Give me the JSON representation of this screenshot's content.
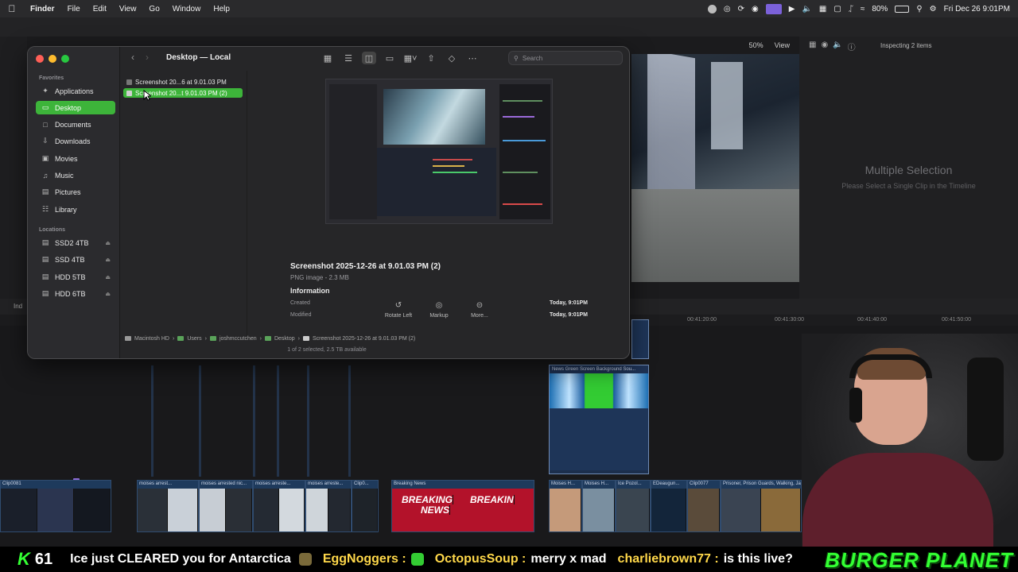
{
  "menubar": {
    "app": "Finder",
    "menus": [
      "File",
      "Edit",
      "View",
      "Go",
      "Window",
      "Help"
    ],
    "battery": "80%",
    "datetime": "Fri Dec 26  9:01PM"
  },
  "viewer": {
    "zoom": "50%",
    "view_label": "View"
  },
  "inspector": {
    "header": "Inspecting 2 items",
    "title": "Multiple Selection",
    "subtitle": "Please Select a Single Clip in the Timeline"
  },
  "timeline": {
    "index_label": "Ind",
    "ruler": [
      "00:41:20:00",
      "00:41:30:00",
      "00:41:40:00",
      "00:41:50:00"
    ],
    "green_screen_clip": "News Green Screen Background Sou...",
    "clips": [
      "Clip0081",
      "moises arrest...",
      "moises arrested nic...",
      "moises arreste...",
      "moises arreste...",
      "Clip0...",
      "Breaking News",
      "Moises H...",
      "Moises H...",
      "Ice Pozol...",
      "EDeaugun...",
      "Clip0077",
      "Prisoner, Prison Guards, Walking, Jail..."
    ],
    "breaking_text": [
      "BREAKING",
      "NEWS",
      "BREAKIN"
    ]
  },
  "finder": {
    "title": "Desktop — Local",
    "search_placeholder": "Search",
    "sidebar": {
      "favorites_label": "Favorites",
      "favorites": [
        "Applications",
        "Desktop",
        "Documents",
        "Downloads",
        "Movies",
        "Music",
        "Pictures",
        "Library"
      ],
      "locations_label": "Locations",
      "locations": [
        "SSD2 4TB",
        "SSD 4TB",
        "HDD 5TB",
        "HDD 6TB"
      ]
    },
    "files": [
      "Screenshot 20...6 at 9.01.03 PM",
      "Screenshot 20...t 9.01.03 PM (2)"
    ],
    "preview": {
      "name": "Screenshot 2025-12-26 at 9.01.03 PM (2)",
      "type": "PNG image - 2.3 MB",
      "info_label": "Information",
      "created_label": "Created",
      "created_value": "Today, 9:01PM",
      "modified_label": "Modified",
      "modified_value": "Today, 9:01PM"
    },
    "actions": [
      "Rotate Left",
      "Markup",
      "More..."
    ],
    "path": [
      "Macintosh HD",
      "Users",
      "joshmccutchen",
      "Desktop",
      "Screenshot 2025-12-26 at 9.01.03 PM (2)"
    ],
    "status": "1 of 2 selected, 2.5 TB available"
  },
  "ticker": {
    "k_label": "K",
    "k_count": "61",
    "lead": "Ice just CLEARED you for Antarctica",
    "messages": [
      {
        "user": "EggNoggers :",
        "text": ""
      },
      {
        "user": "OctopusSoup :",
        "text": "merry x mad"
      },
      {
        "user": "charliebrown77 :",
        "text": "is this live?"
      }
    ],
    "brand": "BURGER PLANET"
  },
  "colors": {
    "accent_green": "#3db43a",
    "ticker_green": "#33ff33",
    "ticker_user": "#ffd84a",
    "traffic_red": "#ff5f57",
    "traffic_yellow": "#febc2e",
    "traffic_green": "#28c840"
  }
}
